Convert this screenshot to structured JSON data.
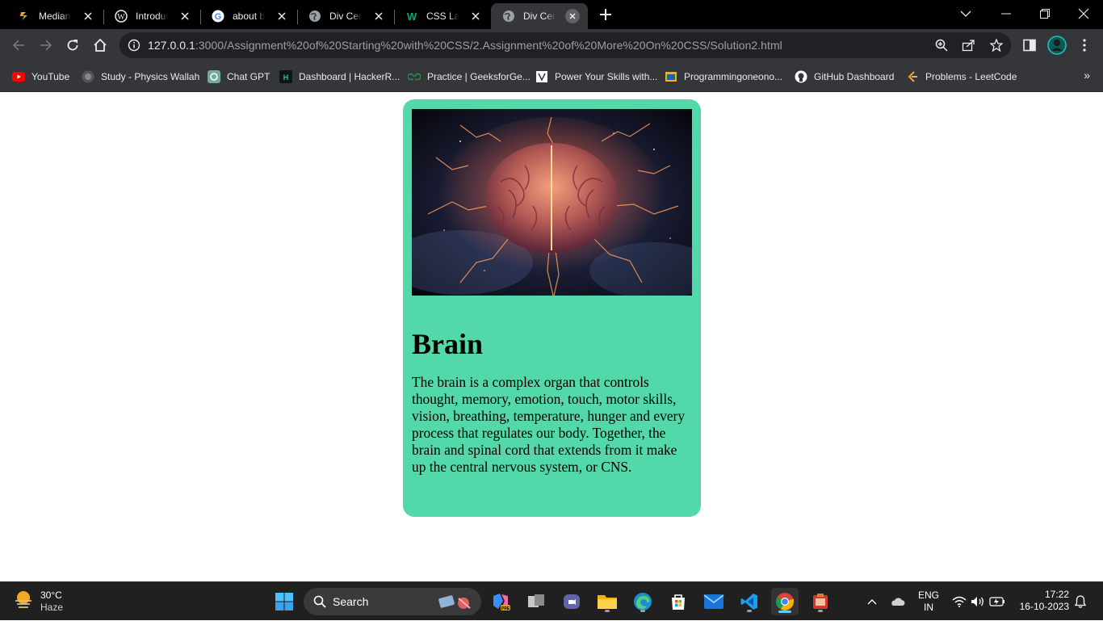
{
  "browser": {
    "tabs": [
      {
        "title": "Median o",
        "icon": "median-icon"
      },
      {
        "title": "Introducti",
        "icon": "wordpress-icon"
      },
      {
        "title": "about bra",
        "icon": "google-icon"
      },
      {
        "title": "Div Cente",
        "icon": "globe-icon"
      },
      {
        "title": "CSS Layo",
        "icon": "w3schools-icon"
      },
      {
        "title": "Div Cente",
        "icon": "globe-icon",
        "active": true
      }
    ],
    "url_host": "127.0.0.1",
    "url_path": ":3000/Assignment%20of%20Starting%20with%20CSS/2.Assignment%20of%20More%20On%20CSS/Solution2.html",
    "bookmarks": [
      {
        "label": "YouTube",
        "icon": "youtube-icon"
      },
      {
        "label": "Study - Physics Wallah",
        "icon": "physics-wallah-icon"
      },
      {
        "label": "Chat GPT",
        "icon": "chatgpt-icon"
      },
      {
        "label": "Dashboard | HackerR...",
        "icon": "hackerrank-icon"
      },
      {
        "label": "Practice | GeeksforGe...",
        "icon": "geeksforgeeks-icon"
      },
      {
        "label": "Power Your Skills with...",
        "icon": "book-icon"
      },
      {
        "label": "Programmingoneono...",
        "icon": "folder-icon"
      },
      {
        "label": "GitHub Dashboard",
        "icon": "github-icon"
      },
      {
        "label": "Problems - LeetCode",
        "icon": "leetcode-icon"
      }
    ],
    "more_bookmarks": "»"
  },
  "page": {
    "card": {
      "image_alt": "brain-image",
      "heading": "Brain",
      "text": "The brain is a complex organ that controls thought, memory, emotion, touch, motor skills, vision, breathing, temperature, hunger and every process that regulates our body. Together, the brain and spinal cord that extends from it make up the central nervous system, or CNS.",
      "bg_color": "#53d8a9"
    }
  },
  "taskbar": {
    "weather": {
      "temp": "30°C",
      "condition": "Haze"
    },
    "search_label": "Search",
    "language": {
      "lang": "ENG",
      "region": "IN"
    },
    "time": "17:22",
    "date": "16-10-2023"
  }
}
